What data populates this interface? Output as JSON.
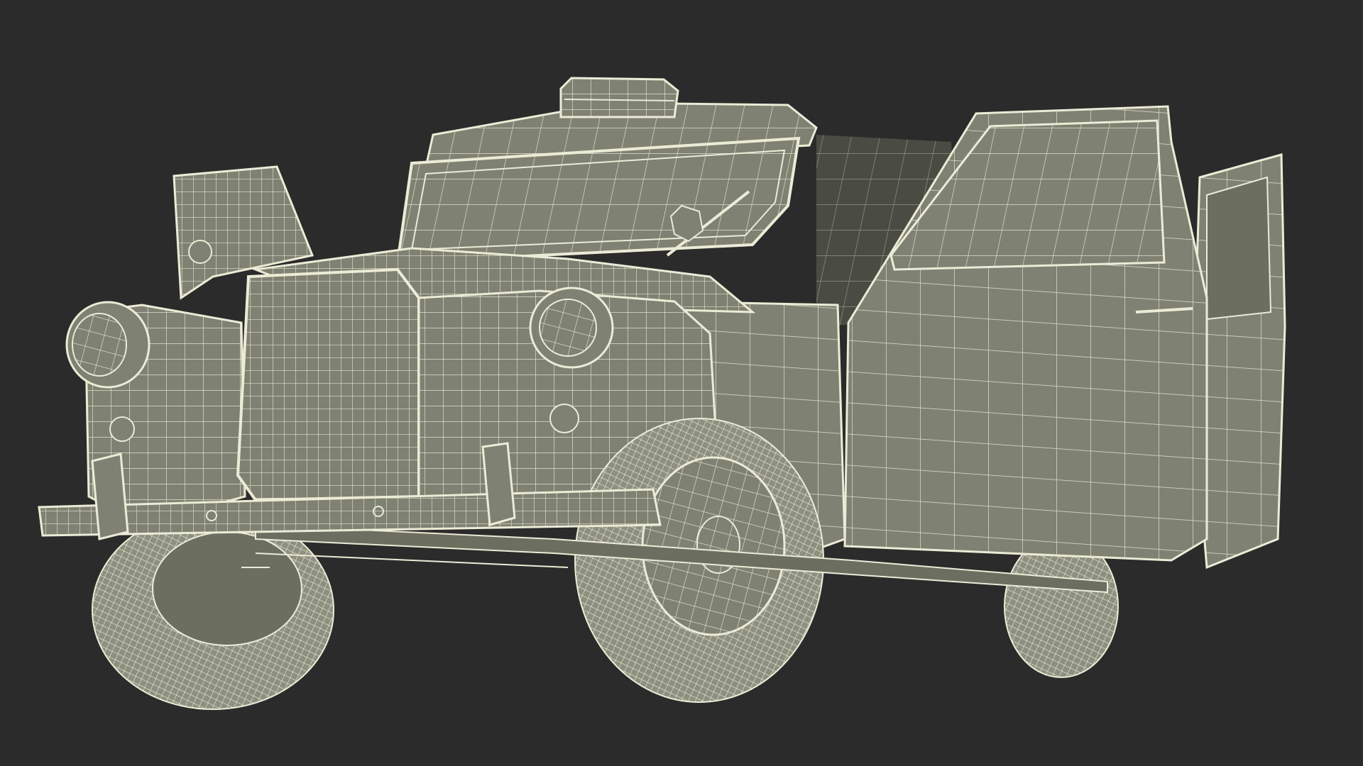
{
  "scene": {
    "background_color": "#2b2b2b",
    "subject": "wireframe-taxi-model",
    "body_color": "#7f8172",
    "body_dark_color": "#6c6e60",
    "interior_color": "#4a4c43",
    "wire_color": "#ecebd6",
    "tire_color": "#8d8f80"
  }
}
